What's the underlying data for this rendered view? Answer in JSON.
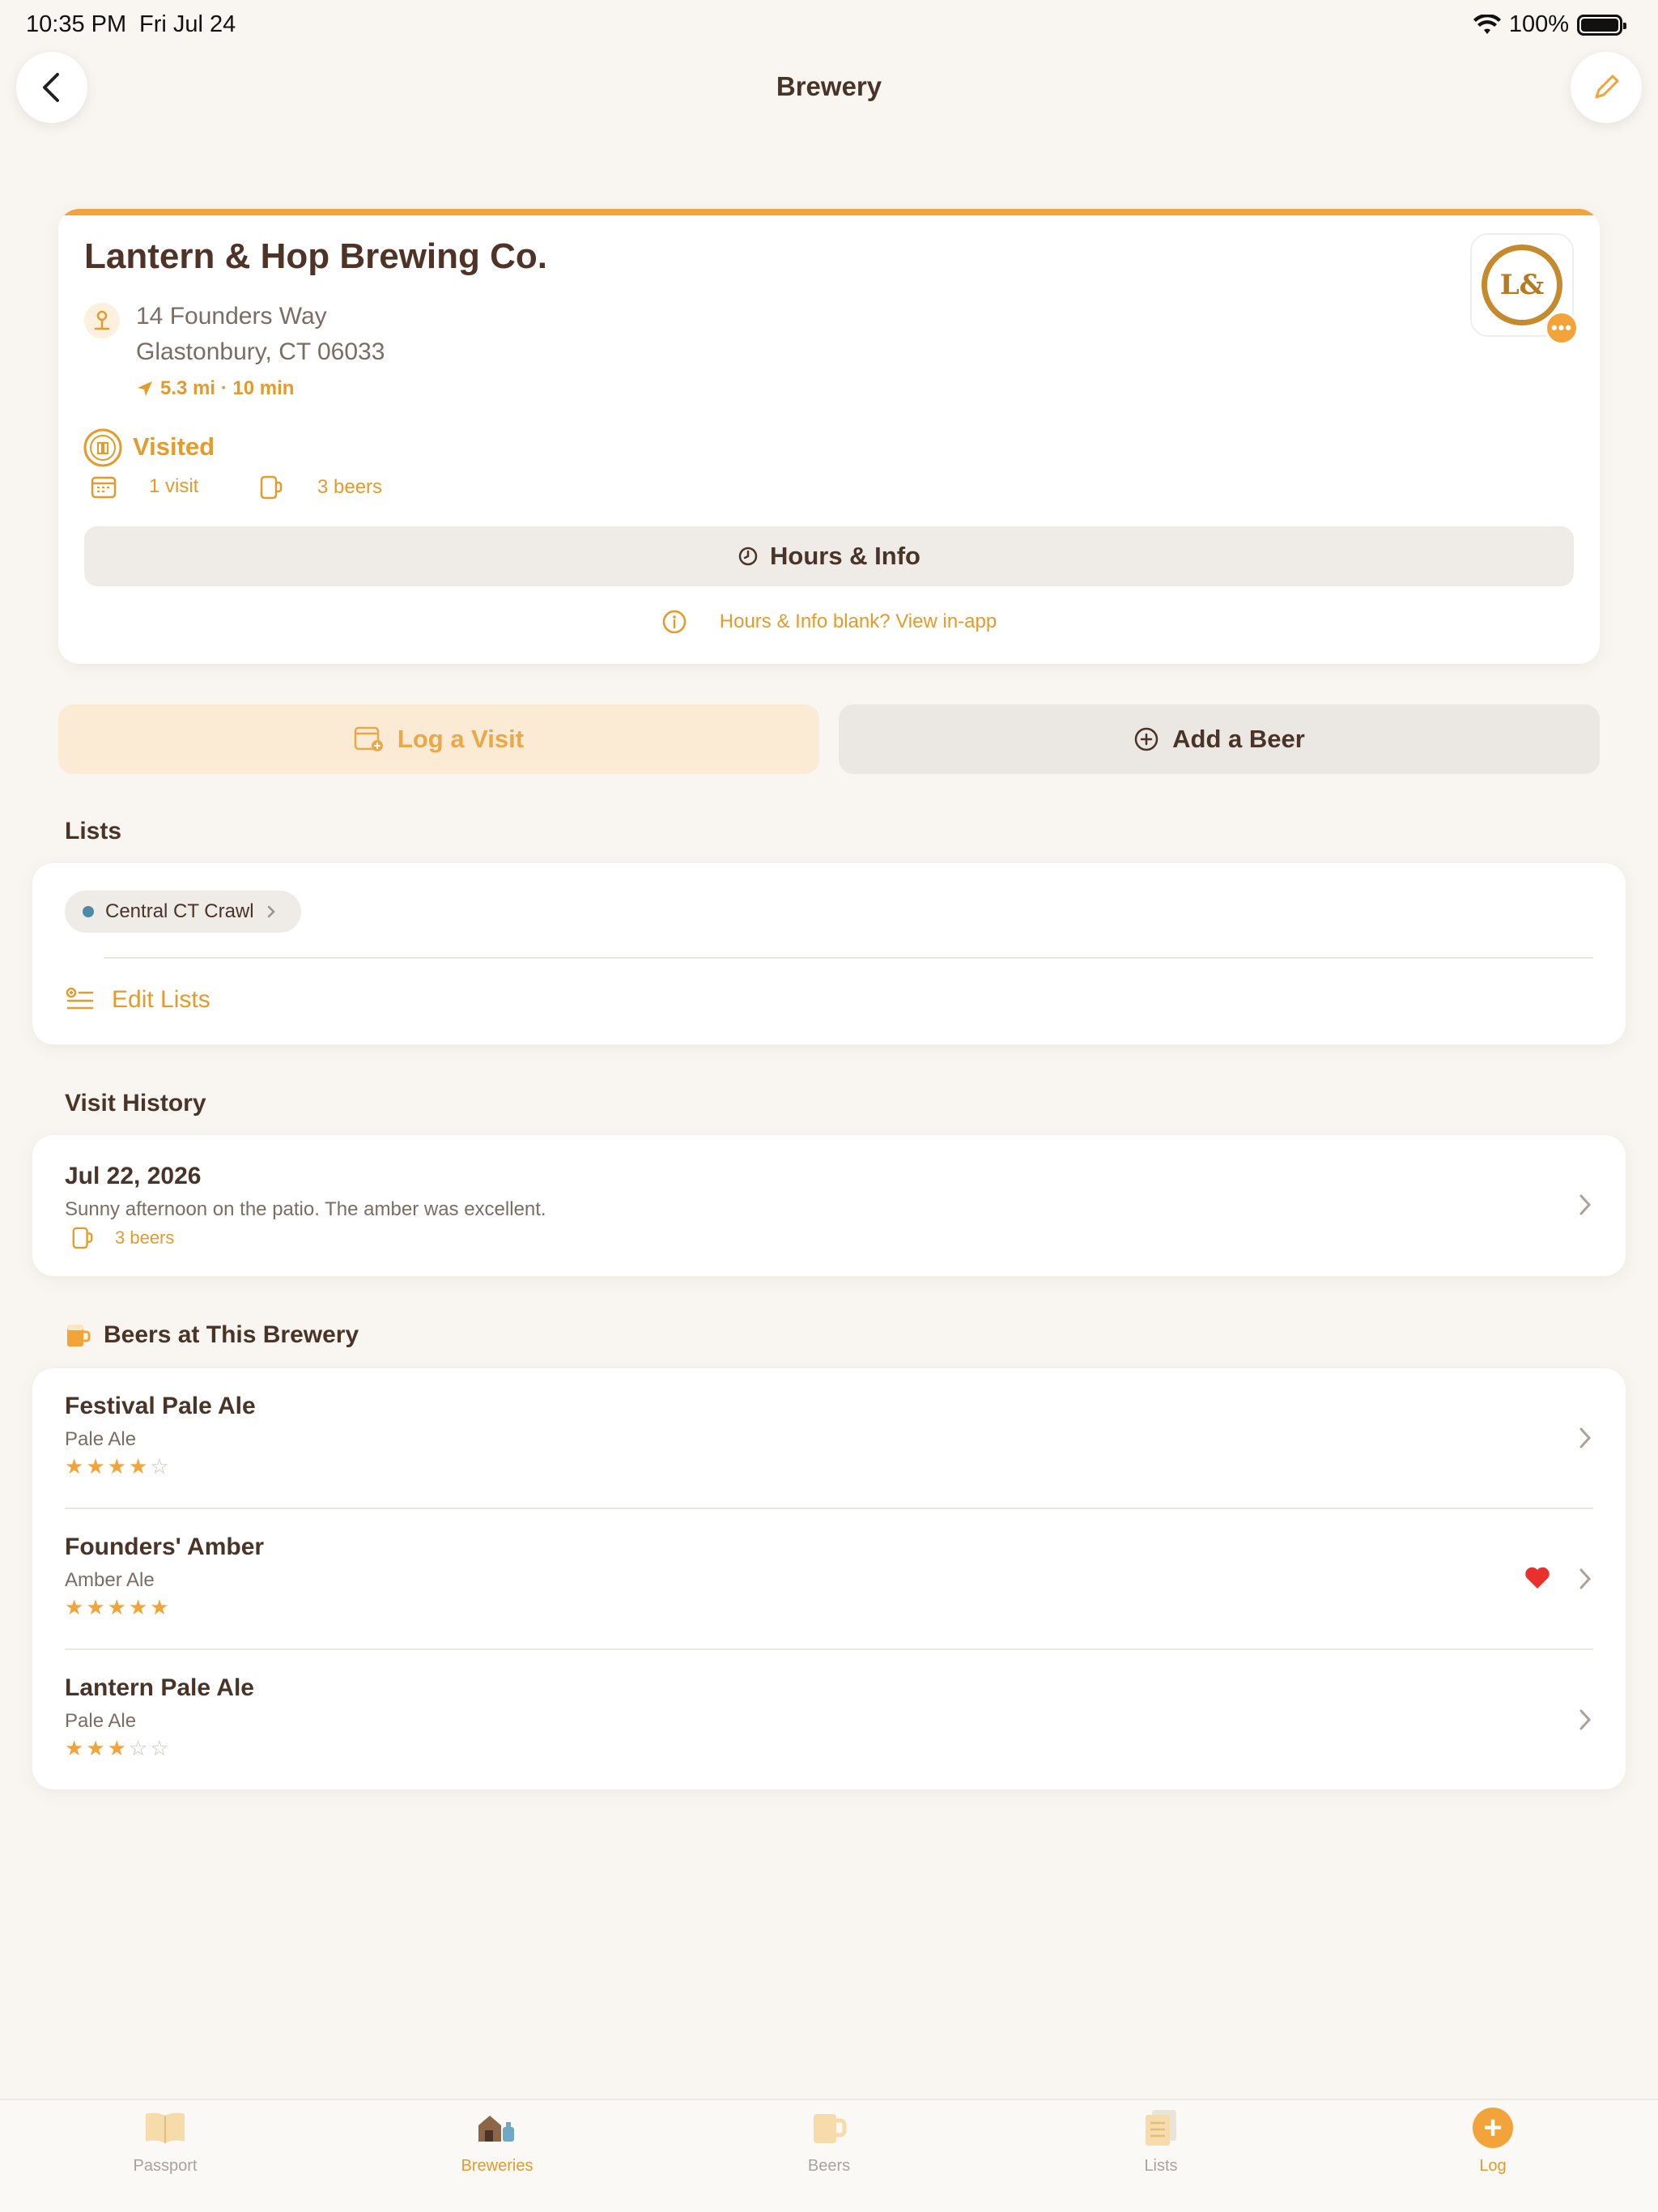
{
  "status": {
    "time": "10:35 PM",
    "date": "Fri Jul 24",
    "battery": "100%"
  },
  "nav": {
    "title": "Brewery"
  },
  "brewery": {
    "name": "Lantern & Hop Brewing Co.",
    "address_line1": "14 Founders Way",
    "address_line2": "Glastonbury, CT 06033",
    "distance": "5.3 mi · 10 min",
    "visited_label": "Visited",
    "visits": "1 visit",
    "beers": "3 beers",
    "hours_button": "Hours & Info",
    "hours_note": "Hours & Info blank? View in-app",
    "logo_text": "L&",
    "more_glyph": "•••"
  },
  "actions": {
    "log_visit": "Log a Visit",
    "add_beer": "Add a Beer"
  },
  "lists": {
    "header": "Lists",
    "chips": [
      {
        "label": "Central CT Crawl",
        "color": "#4e8aa4"
      }
    ],
    "edit_label": "Edit Lists"
  },
  "visit_history": {
    "header": "Visit History",
    "visits": [
      {
        "date": "Jul 22, 2026",
        "note": "Sunny afternoon on the patio. The amber was excellent.",
        "beers": "3 beers"
      }
    ]
  },
  "beers_section": {
    "header": "Beers at This Brewery",
    "beers": [
      {
        "name": "Festival Pale Ale",
        "style": "Pale Ale",
        "rating": 4,
        "favorite": false
      },
      {
        "name": "Founders' Amber",
        "style": "Amber Ale",
        "rating": 5,
        "favorite": true
      },
      {
        "name": "Lantern Pale Ale",
        "style": "Pale Ale",
        "rating": 3,
        "favorite": false
      }
    ]
  },
  "tabbar": {
    "tabs": [
      {
        "label": "Passport",
        "icon": "passport-icon"
      },
      {
        "label": "Breweries",
        "icon": "brewery-icon"
      },
      {
        "label": "Beers",
        "icon": "beer-mug-icon"
      },
      {
        "label": "Lists",
        "icon": "lists-icon"
      },
      {
        "label": "Log",
        "icon": "plus-icon"
      }
    ],
    "active": "Breweries"
  },
  "colors": {
    "accent": "#f2a33a",
    "accent_text": "#e59a2a",
    "background": "#f9f6f1",
    "text": "#4a3428",
    "heart": "#e8302d"
  }
}
